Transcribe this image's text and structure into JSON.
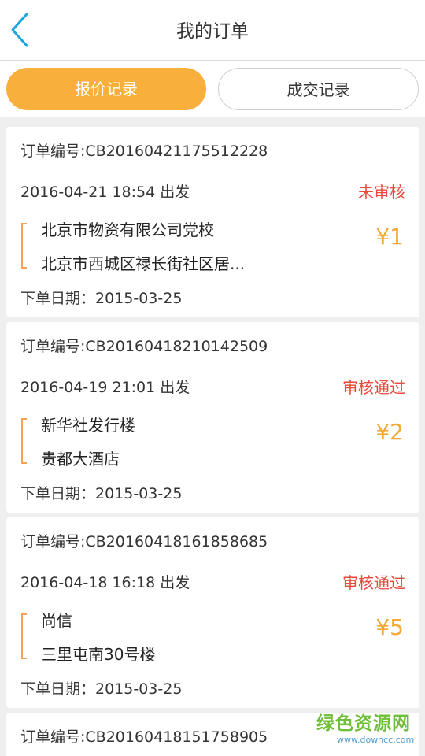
{
  "header": {
    "title": "我的订单",
    "back_icon": "chevron-left-icon"
  },
  "tabs": [
    {
      "label": "报价记录",
      "active": true
    },
    {
      "label": "成交记录",
      "active": false
    }
  ],
  "orders": [
    {
      "order_no": "订单编号:CB20160421175512228",
      "departure": "2016-04-21 18:54 出发",
      "status": "未审核",
      "from": "北京市物资有限公司党校",
      "to": "北京市西城区禄长街社区居...",
      "price": "¥1",
      "order_date": "下单日期：2015-03-25"
    },
    {
      "order_no": "订单编号:CB20160418210142509",
      "departure": "2016-04-19 21:01 出发",
      "status": "审核通过",
      "from": "新华社发行楼",
      "to": "贵都大酒店",
      "price": "¥2",
      "order_date": "下单日期：2015-03-25"
    },
    {
      "order_no": "订单编号:CB20160418161858685",
      "departure": "2016-04-18 16:18 出发",
      "status": "审核通过",
      "from": "尚信",
      "to": "三里屯南30号楼",
      "price": "¥5",
      "order_date": "下单日期：2015-03-25"
    },
    {
      "order_no": "订单编号:CB20160418151758905"
    }
  ],
  "watermark": {
    "name": "绿色资源网",
    "url": "www.downcc.com"
  },
  "colors": {
    "accent": "#f9af3c",
    "status_red": "#e84a3e",
    "price_orange": "#f4aa36",
    "back_blue": "#1aa7e0"
  }
}
